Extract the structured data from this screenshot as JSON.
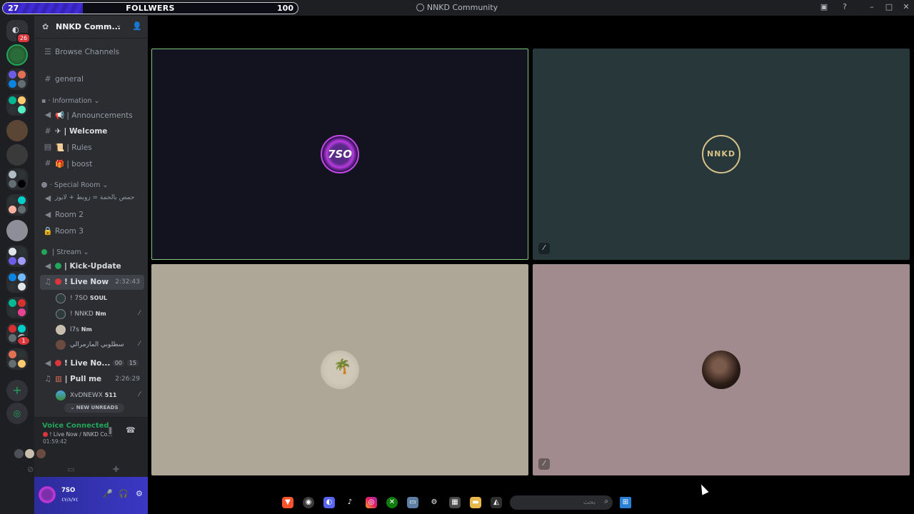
{
  "followers_bar": {
    "current": "27",
    "label": "FOLLWERS",
    "goal": "100",
    "progress": 0.27,
    "fill_color": "#3f2bd6"
  },
  "window": {
    "title": "NNKD Community",
    "controls": [
      "inbox-icon",
      "help-icon",
      "minimize-icon",
      "maximize-icon",
      "close-icon"
    ]
  },
  "server_rail": {
    "home_badge": "26",
    "unread_badge": "1"
  },
  "server": {
    "name": "NNKD Comm...",
    "browse_channels": "Browse Channels",
    "channels_top": [
      {
        "name": "general",
        "icon": "hash-icon"
      }
    ],
    "categories": [
      {
        "name": "Information",
        "channels": [
          {
            "name": "Announcements",
            "icon": "speaker-icon",
            "emoji": "megaphone"
          },
          {
            "name": "Welcome",
            "icon": "hash-icon",
            "emoji": "plane"
          },
          {
            "name": "Rules",
            "icon": "rules-icon",
            "emoji": "scroll"
          },
          {
            "name": "boost",
            "icon": "hash-icon",
            "emoji": "gift"
          }
        ]
      },
      {
        "name": "Special Room",
        "channels": [
          {
            "name": "حمص بالحمة = زوبط + لايوز",
            "icon": "speaker-icon"
          },
          {
            "name": "Room 2",
            "icon": "speaker-icon"
          },
          {
            "name": "Room 3",
            "icon": "lock-icon"
          }
        ]
      },
      {
        "name": "Stream",
        "channels": [
          {
            "name": "Kick-Update",
            "icon": "speaker-icon"
          },
          {
            "name": "Live Now",
            "icon": "voice-icon",
            "time": "2:32:43"
          },
          {
            "name": "Live No...",
            "icon": "voice-icon",
            "counts": [
              "00",
              "15"
            ]
          },
          {
            "name": "Pull me",
            "icon": "voice-icon",
            "time": "2:26:29"
          }
        ]
      }
    ],
    "live_now_users": [
      {
        "name": "! 7SO",
        "tag": "SOUL"
      },
      {
        "name": "! NNKD",
        "tag": "Nm",
        "muted": true
      },
      {
        "name": "l7s",
        "tag": "Nm"
      },
      {
        "name": "سطلوبي المارمرالي",
        "muted": true
      }
    ],
    "pull_me_users": [
      {
        "name": "XvDNEWX",
        "tag": "511",
        "muted": true
      }
    ],
    "new_unreads": "NEW UNREADS"
  },
  "voice_panel": {
    "title": "Voice Connected",
    "location": "! Live Now / NNKD Co...",
    "elapsed": "01:59:42"
  },
  "user_panel": {
    "name": "7SO",
    "status": "٤٧/٨/٧٤"
  },
  "stage": {
    "tiles": [
      {
        "label": "7SO",
        "bg": "#13131f",
        "speaking": true,
        "muted": false
      },
      {
        "label": "NNKD",
        "bg": "#27373a",
        "speaking": false,
        "muted": true
      },
      {
        "label": "",
        "bg": "#aea696",
        "speaking": false,
        "muted": false
      },
      {
        "label": "",
        "bg": "#a28b8e",
        "speaking": false,
        "muted": true
      }
    ]
  },
  "taskbar": {
    "apps": [
      "brave-icon",
      "chrome-icon",
      "discord-icon",
      "tiktok-icon",
      "instagram-icon",
      "xbox-icon",
      "window-icon",
      "steam-icon",
      "store-icon",
      "folder-icon",
      "app-icon"
    ],
    "search_placeholder": "بحث"
  }
}
